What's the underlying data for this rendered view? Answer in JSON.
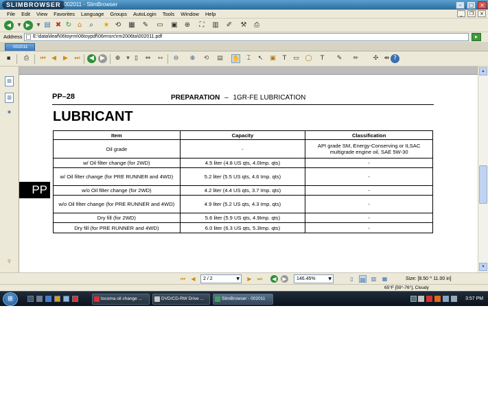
{
  "window": {
    "logo_text": "SLIMBROWSER",
    "title": "002011 - SlimBrowser",
    "minimize_glyph": "–",
    "maximize_glyph": "□",
    "close_glyph": "×"
  },
  "menu": {
    "items": [
      "File",
      "Edit",
      "View",
      "Favorites",
      "Language",
      "Groups",
      "AutoLogin",
      "Tools",
      "Window",
      "Help"
    ]
  },
  "address": {
    "label": "Address",
    "value": "E:\\data\\ileaf\\06toyrm\\06toypdf\\06rmsrc\\rm2006ta\\002011.pdf"
  },
  "tab": {
    "label": "002011"
  },
  "document": {
    "page_code": "PP–28",
    "section_bold": "PREPARATION",
    "section_dash": "–",
    "section_rest": "1GR-FE LUBRICATION",
    "heading": "LUBRICANT",
    "side_tab": "PP",
    "table": {
      "headers": [
        "Item",
        "Capacity",
        "Classification"
      ],
      "rows": [
        [
          "Oil grade",
          "-",
          "API grade SM, Energy-Conserving or ILSAC multigrade engine oil, SAE 5W-30"
        ],
        [
          "w/ Oil filter change (for 2WD)",
          "4.5 liter (4.8 US qts, 4.0Imp. qts)",
          "-"
        ],
        [
          "w/ Oil filter change (for PRE RUNNER and 4WD)",
          "5.2 liter (5.5 US qts, 4.6 Imp. qts)",
          "-"
        ],
        [
          "w/o Oil filter change (for 2WD)",
          "4.2 liter (4.4 US qts, 3.7 Imp. qts)",
          "-"
        ],
        [
          "w/o Oil filter change (for PRE RUNNER and 4WD)",
          "4.9 liter (5.2 US qts, 4.3 Imp. qts)",
          "-"
        ],
        [
          "Dry fill (for 2WD)",
          "5.6 liter (5.9 US qts, 4.9Imp. qts)",
          "-"
        ],
        [
          "Dry fill (for PRE RUNNER and 4WD)",
          "6.0 liter (6.3 US qts, 5.3Imp. qts)",
          "-"
        ]
      ]
    }
  },
  "navigation": {
    "page_value": "2 / 2",
    "zoom_value": "146.45%",
    "size_text": "Size: [8.50 ^ 11.00 in]"
  },
  "weather": {
    "text": "65°F [59°-76°], Cloudy"
  },
  "taskbar": {
    "start_glyph": "⊞",
    "tasks": [
      {
        "label": "tocoma oil change ...",
        "color": "#d83030"
      },
      {
        "label": "DVD/CD-RW Drive ...",
        "color": "#c8c8c8"
      },
      {
        "label": "SlimBrowser - 002011",
        "color": "#3aa55a"
      }
    ],
    "clock": "3:57 PM"
  },
  "colors": {
    "titlebar": "#3a7fb0",
    "chrome": "#ece9d8",
    "taskbar": "#0b131c"
  }
}
